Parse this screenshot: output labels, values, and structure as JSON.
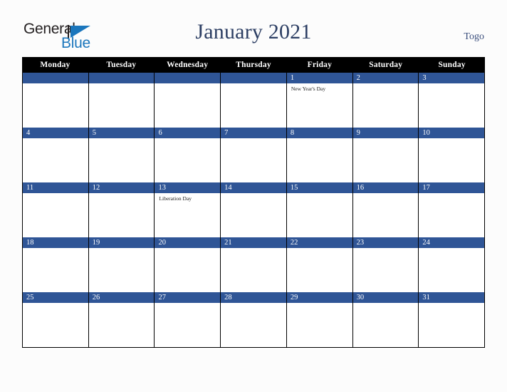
{
  "brand": {
    "name_top": "General",
    "name_bottom": "Blue",
    "accent_color": "#1b76bc"
  },
  "header": {
    "title": "January 2021",
    "region": "Togo"
  },
  "colors": {
    "day_bar": "#2f5596",
    "weekday_header_bg": "#000000",
    "title_color": "#2c3e63",
    "page_bg": "#fcfcfc"
  },
  "calendar": {
    "weekdays": [
      "Monday",
      "Tuesday",
      "Wednesday",
      "Thursday",
      "Friday",
      "Saturday",
      "Sunday"
    ],
    "weeks": [
      [
        {
          "date": "",
          "events": []
        },
        {
          "date": "",
          "events": []
        },
        {
          "date": "",
          "events": []
        },
        {
          "date": "",
          "events": []
        },
        {
          "date": "1",
          "events": [
            "New Year's Day"
          ]
        },
        {
          "date": "2",
          "events": []
        },
        {
          "date": "3",
          "events": []
        }
      ],
      [
        {
          "date": "4",
          "events": []
        },
        {
          "date": "5",
          "events": []
        },
        {
          "date": "6",
          "events": []
        },
        {
          "date": "7",
          "events": []
        },
        {
          "date": "8",
          "events": []
        },
        {
          "date": "9",
          "events": []
        },
        {
          "date": "10",
          "events": []
        }
      ],
      [
        {
          "date": "11",
          "events": []
        },
        {
          "date": "12",
          "events": []
        },
        {
          "date": "13",
          "events": [
            "Liberation Day"
          ]
        },
        {
          "date": "14",
          "events": []
        },
        {
          "date": "15",
          "events": []
        },
        {
          "date": "16",
          "events": []
        },
        {
          "date": "17",
          "events": []
        }
      ],
      [
        {
          "date": "18",
          "events": []
        },
        {
          "date": "19",
          "events": []
        },
        {
          "date": "20",
          "events": []
        },
        {
          "date": "21",
          "events": []
        },
        {
          "date": "22",
          "events": []
        },
        {
          "date": "23",
          "events": []
        },
        {
          "date": "24",
          "events": []
        }
      ],
      [
        {
          "date": "25",
          "events": []
        },
        {
          "date": "26",
          "events": []
        },
        {
          "date": "27",
          "events": []
        },
        {
          "date": "28",
          "events": []
        },
        {
          "date": "29",
          "events": []
        },
        {
          "date": "30",
          "events": []
        },
        {
          "date": "31",
          "events": []
        }
      ]
    ]
  }
}
